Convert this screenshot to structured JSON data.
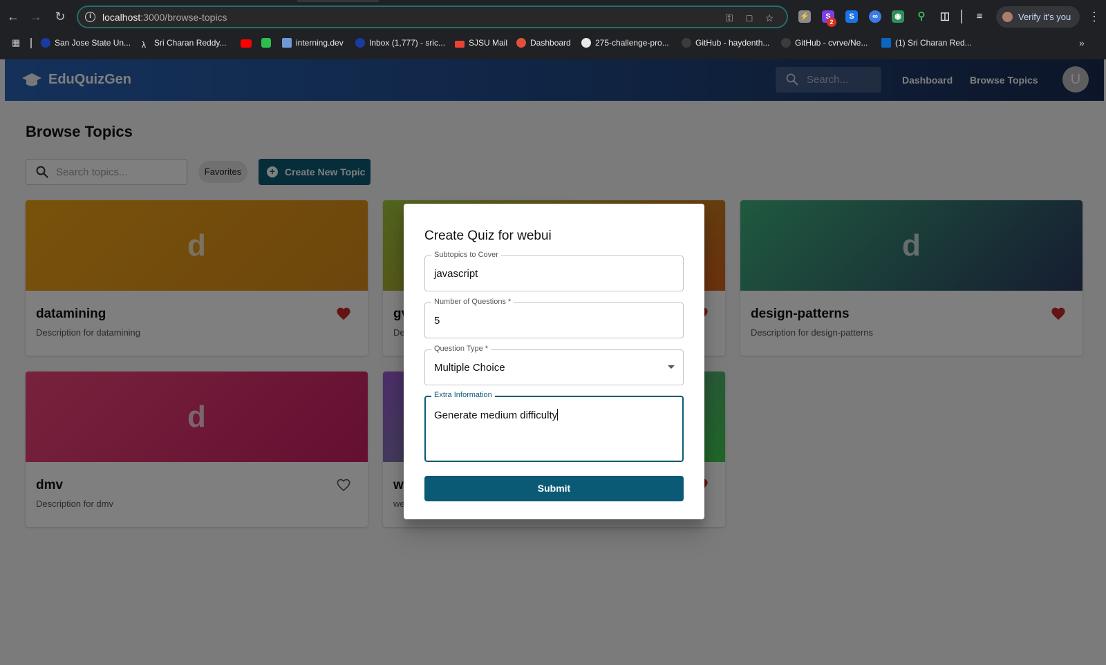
{
  "browser": {
    "url_host": "localhost",
    "url_path": ":3000/browse-topics",
    "verify_label": "Verify it's you",
    "extension_badge": "2",
    "bookmarks": [
      {
        "label": "San Jose State Un...",
        "color": "#1a3a9f"
      },
      {
        "label": "Sri Charan Reddy...",
        "color": "#e8e8e8"
      },
      {
        "label": "",
        "color": "#ff0000"
      },
      {
        "label": "",
        "color": "#2cbe4e"
      },
      {
        "label": "interning.dev",
        "color": "#6d9ad6"
      },
      {
        "label": "Inbox (1,777) - sric...",
        "color": "#1a3a9f"
      },
      {
        "label": "SJSU Mail",
        "color": "#ea4335"
      },
      {
        "label": "Dashboard",
        "color": "#e0503c"
      },
      {
        "label": "275-challenge-pro...",
        "color": "#e8e8e8"
      },
      {
        "label": "GitHub - haydenth...",
        "color": "#3c3c3c"
      },
      {
        "label": "GitHub - cvrve/Ne...",
        "color": "#3c3c3c"
      },
      {
        "label": "(1) Sri Charan Red...",
        "color": "#0a66c2"
      }
    ]
  },
  "appbar": {
    "brand": "EduQuizGen",
    "search_placeholder": "Search...",
    "nav": [
      "Dashboard",
      "Browse Topics"
    ],
    "avatar_initial": "U"
  },
  "page": {
    "title": "Browse Topics",
    "search_placeholder": "Search topics...",
    "favorites_label": "Favorites",
    "create_label": "Create New Topic"
  },
  "cards": [
    {
      "letter": "d",
      "title": "datamining",
      "description": "Description for datamining",
      "favorite": true
    },
    {
      "letter": "",
      "title": "gv",
      "description": "De",
      "favorite": true
    },
    {
      "letter": "d",
      "title": "design-patterns",
      "description": "Description for design-patterns",
      "favorite": true
    },
    {
      "letter": "d",
      "title": "dmv",
      "description": "Description for dmv",
      "favorite": false
    },
    {
      "letter": "",
      "title": "w",
      "description": "we",
      "favorite": true
    }
  ],
  "modal": {
    "title": "Create Quiz for webui",
    "subtopics_label": "Subtopics to Cover",
    "subtopics_value": "javascript",
    "questions_label": "Number of Questions *",
    "questions_value": "5",
    "type_label": "Question Type *",
    "type_value": "Multiple Choice",
    "extra_label": "Extra Information",
    "extra_value": "Generate medium difficulty",
    "submit_label": "Submit"
  },
  "colors": {
    "primary": "#0b5a75",
    "heart": "#c62828"
  }
}
